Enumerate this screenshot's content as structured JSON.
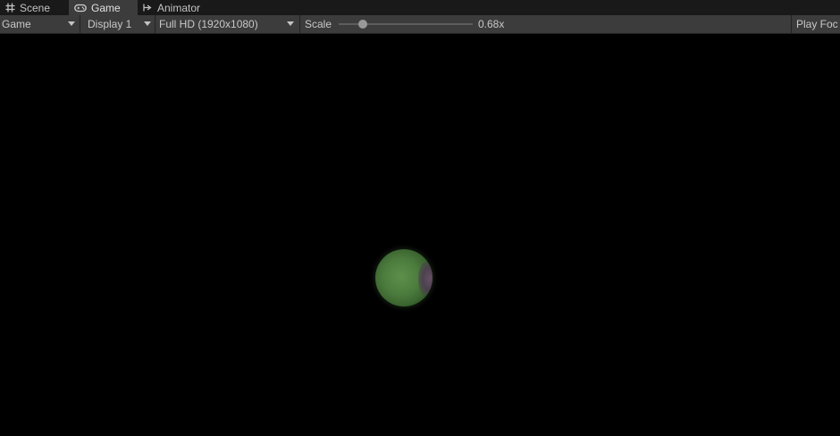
{
  "tabs": [
    {
      "label": "Scene",
      "icon": "grid-icon",
      "active": false
    },
    {
      "label": "Game",
      "icon": "gamepad-icon",
      "active": true
    },
    {
      "label": "Animator",
      "icon": "animator-icon",
      "active": false
    }
  ],
  "toolbar": {
    "mode_dropdown": "Game",
    "display_dropdown": "Display 1",
    "resolution_dropdown": "Full HD (1920x1080)",
    "scale_label": "Scale",
    "scale_value": "0.68x",
    "scale_fraction": 0.18,
    "play_focused": "Play Foc"
  },
  "colors": {
    "tab_bar_bg": "#191919",
    "toolbar_bg": "#3c3c3c",
    "viewport_bg": "#000000",
    "planet_green": "#4d7d3e"
  }
}
